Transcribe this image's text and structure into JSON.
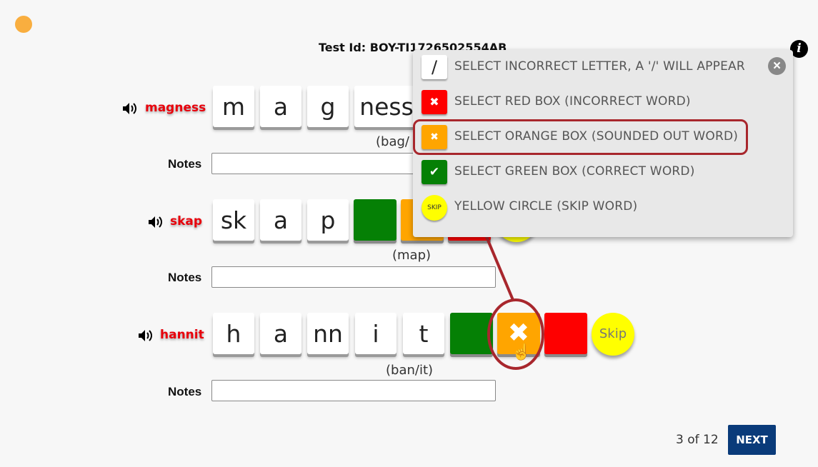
{
  "header": {
    "test_id": "Test Id: BOY-TI1726502554AB"
  },
  "rows": [
    {
      "word": "magness",
      "tiles": [
        "m",
        "a",
        "g",
        "ness"
      ],
      "hint": "(bag/",
      "notes_label": "Notes",
      "notes_value": ""
    },
    {
      "word": "skap",
      "tiles": [
        "sk",
        "a",
        "p"
      ],
      "hint": "(map)",
      "notes_label": "Notes",
      "notes_value": ""
    },
    {
      "word": "hannit",
      "tiles": [
        "h",
        "a",
        "nn",
        "i",
        "t"
      ],
      "hint": "(ban/it)",
      "notes_label": "Notes",
      "notes_value": "",
      "skip_label": "Skip"
    }
  ],
  "legend": {
    "items": [
      {
        "swatch": "/",
        "text": "SELECT INCORRECT LETTER, A '/' WILL APPEAR",
        "color": "#ffffff"
      },
      {
        "swatch": "✖",
        "text": "SELECT RED BOX (INCORRECT WORD)",
        "color": "#fe0000"
      },
      {
        "swatch": "✖",
        "text": "SELECT ORANGE BOX (SOUNDED OUT WORD)",
        "color": "#ffa500"
      },
      {
        "swatch": "✔",
        "text": "SELECT GREEN BOX (CORRECT WORD)",
        "color": "#058005"
      },
      {
        "swatch": "SKIP",
        "text": "YELLOW CIRCLE (SKIP WORD)",
        "color": "#ffff00"
      }
    ],
    "close_icon": "close-icon"
  },
  "pagination": {
    "position": "3 of 12",
    "next_label": "NEXT"
  },
  "colors": {
    "highlight": "#a8272d",
    "next_button": "#0a3b7a",
    "status_dot": "#f9ae3f"
  }
}
